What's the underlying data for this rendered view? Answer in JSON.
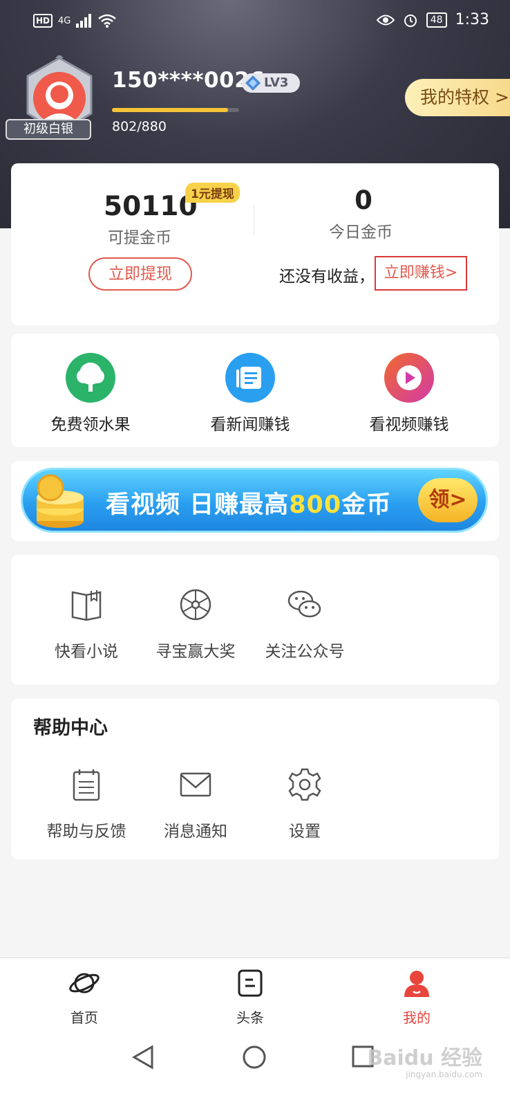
{
  "status_bar": {
    "network_hd": "HD",
    "network_gen": "4G",
    "battery": "48",
    "time": "1:33"
  },
  "profile": {
    "rank_badge": "初级白银",
    "phone": "150****0026",
    "level": "LV3",
    "exp_text": "802/880",
    "exp_progress": 0.9114,
    "privilege_button": "我的特权 >"
  },
  "coins": {
    "withdrawable_value": "50110",
    "withdraw_tag": "1元提现",
    "withdrawable_label": "可提金币",
    "today_value": "0",
    "today_label": "今日金币",
    "withdraw_button": "立即提现",
    "no_income_text": "还没有收益，",
    "earn_link": "立即赚钱>"
  },
  "tasks": [
    {
      "label": "免费领水果",
      "icon": "tree-icon",
      "color": "#2bb36a"
    },
    {
      "label": "看新闻赚钱",
      "icon": "news-icon",
      "color": "#2a9ff0"
    },
    {
      "label": "看视频赚钱",
      "icon": "play-icon",
      "color": "#e0409a"
    }
  ],
  "banner": {
    "text_before": "看视频 日赚最高",
    "highlight": "800",
    "text_after": "金币",
    "claim": "领>"
  },
  "tools": [
    {
      "label": "快看小说",
      "icon": "book-icon"
    },
    {
      "label": "寻宝赢大奖",
      "icon": "wheel-icon"
    },
    {
      "label": "关注公众号",
      "icon": "wechat-icon"
    }
  ],
  "help": {
    "title": "帮助中心",
    "items": [
      {
        "label": "帮助与反馈",
        "icon": "clipboard-icon"
      },
      {
        "label": "消息通知",
        "icon": "mail-icon"
      },
      {
        "label": "设置",
        "icon": "gear-icon"
      }
    ]
  },
  "bottom_nav": [
    {
      "label": "首页",
      "icon": "planet-icon",
      "active": false
    },
    {
      "label": "头条",
      "icon": "headline-icon",
      "active": false
    },
    {
      "label": "我的",
      "icon": "profile-icon",
      "active": true
    }
  ],
  "watermark": {
    "brand": "Baidu 经验",
    "url": "jingyan.baidu.com"
  },
  "colors": {
    "accent_red": "#e05a4e",
    "gold": "#f5c437",
    "header_dark": "#2a2a36"
  }
}
